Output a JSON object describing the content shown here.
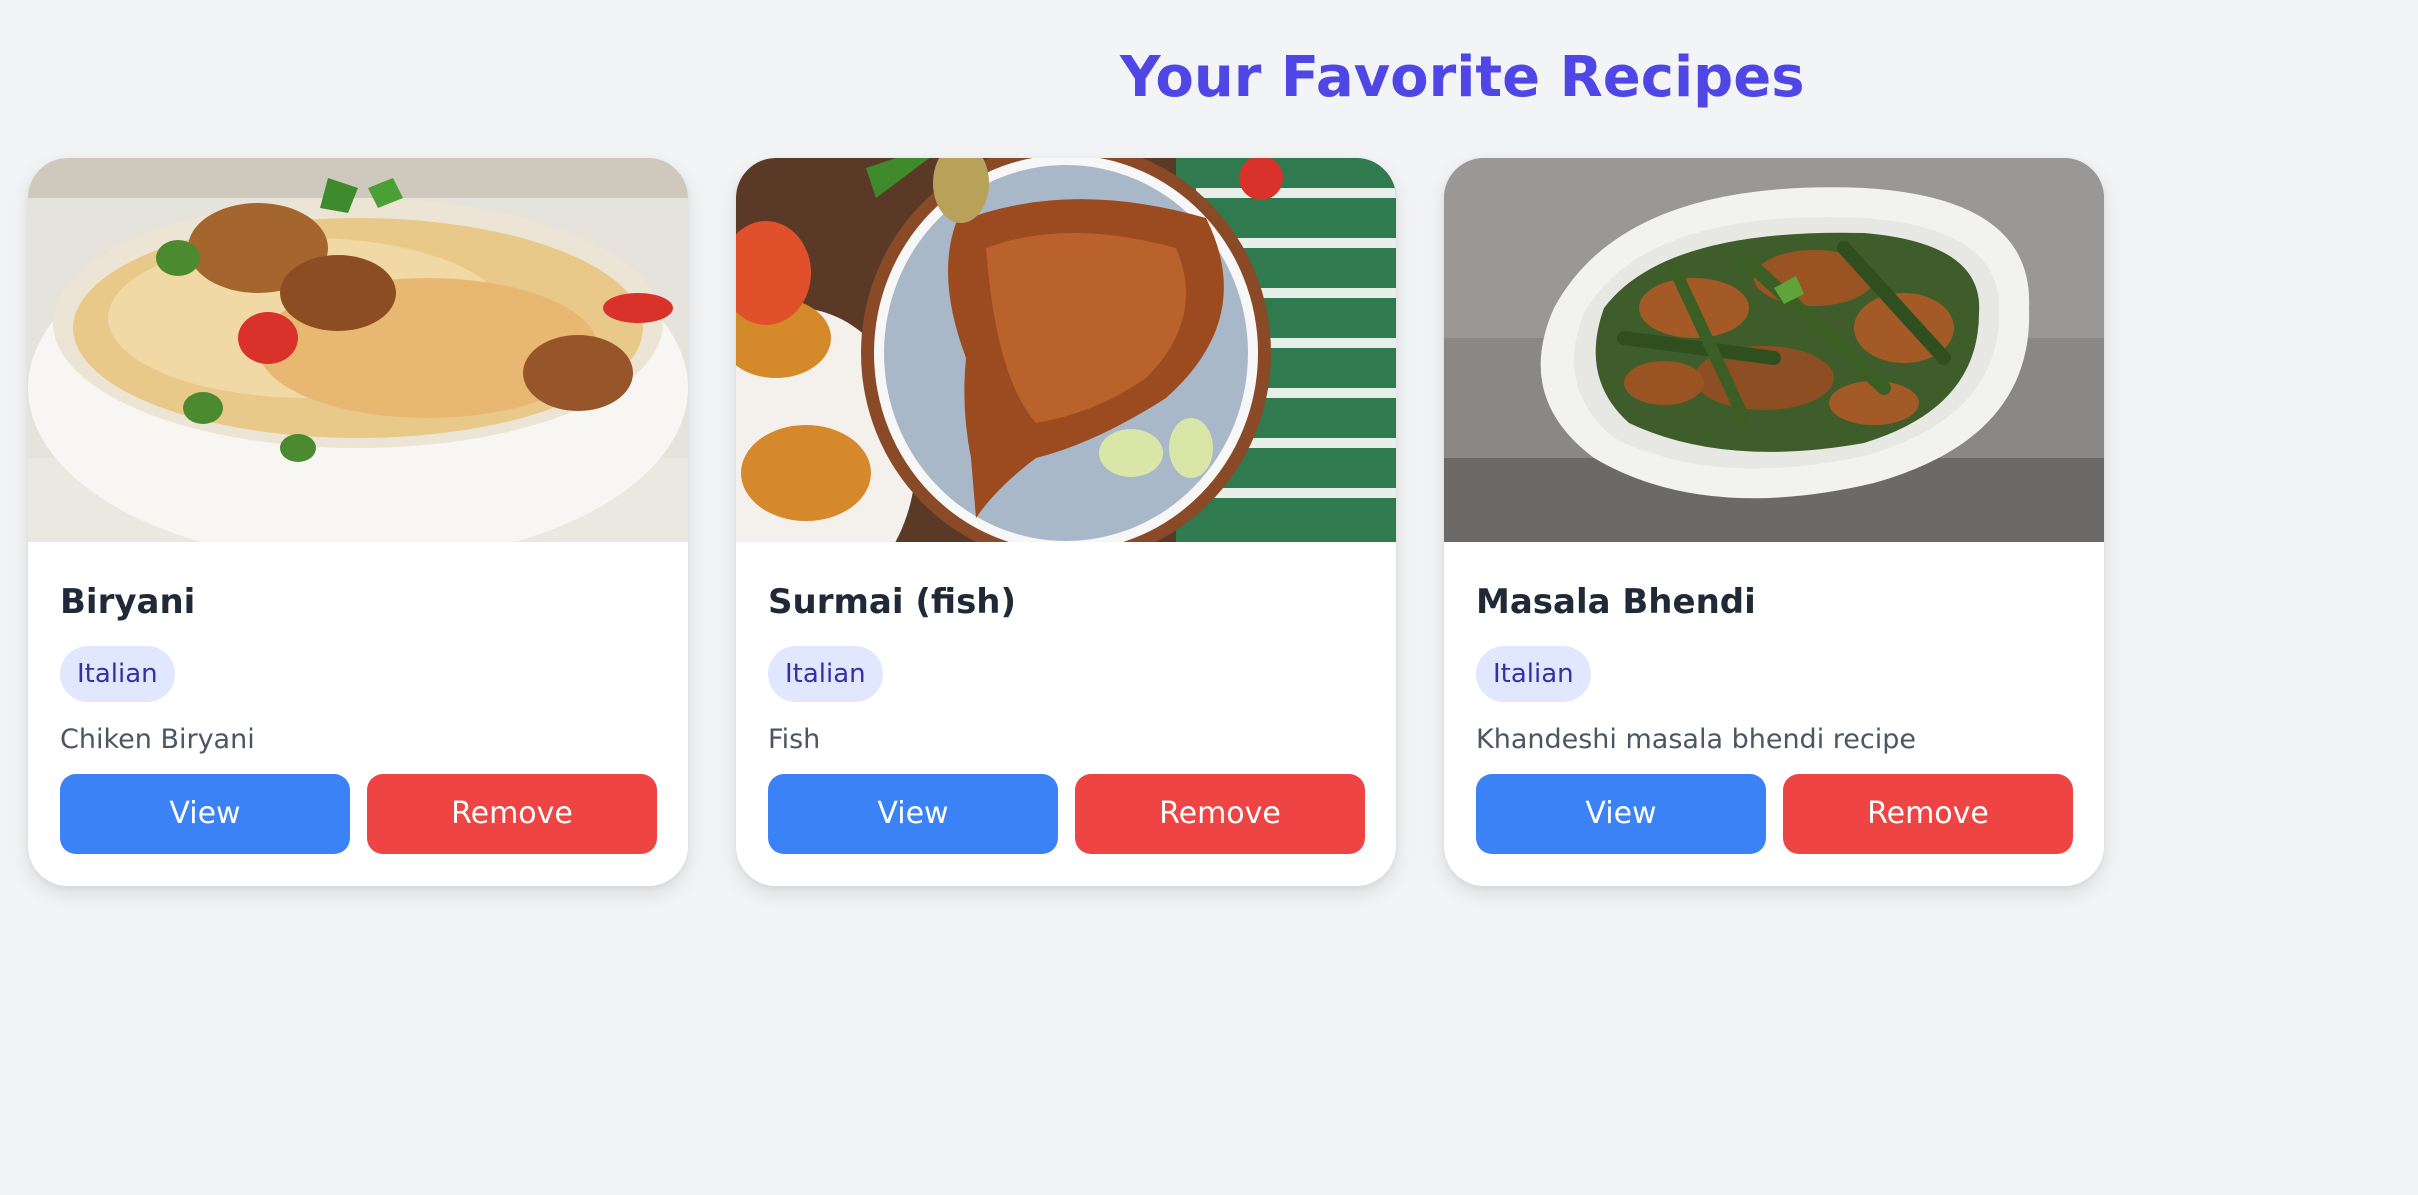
{
  "header": {
    "title": "Your Favorite Recipes"
  },
  "colors": {
    "title": "#4f46e5",
    "view_button": "#3b82f6",
    "remove_button": "#ef4444",
    "tag_bg": "#e0e7ff",
    "tag_text": "#3730a3",
    "page_bg": "#f3f4f6"
  },
  "recipes": [
    {
      "image_icon": "biryani-photo",
      "title": "Biryani",
      "tag": "Italian",
      "description": "Chiken Biryani",
      "view_label": "View",
      "remove_label": "Remove"
    },
    {
      "image_icon": "surmai-fish-photo",
      "title": "Surmai (fish)",
      "tag": "Italian",
      "description": "Fish",
      "view_label": "View",
      "remove_label": "Remove"
    },
    {
      "image_icon": "masala-bhendi-photo",
      "title": "Masala Bhendi",
      "tag": "Italian",
      "description": "Khandeshi masala bhendi recipe",
      "view_label": "View",
      "remove_label": "Remove"
    }
  ]
}
